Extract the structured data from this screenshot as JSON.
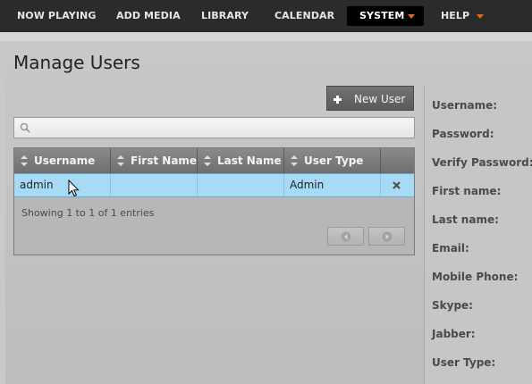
{
  "nav": {
    "items": [
      {
        "label": "NOW PLAYING"
      },
      {
        "label": "ADD MEDIA"
      },
      {
        "label": "LIBRARY"
      },
      {
        "label": "CALENDAR"
      },
      {
        "label": "SYSTEM"
      },
      {
        "label": "HELP"
      }
    ],
    "active": "SYSTEM",
    "caret_color": "#e8661a"
  },
  "page": {
    "title": "Manage Users",
    "new_user_label": "New User",
    "search_placeholder": "",
    "search_value": ""
  },
  "table": {
    "columns": [
      "Username",
      "First Name",
      "Last Name",
      "User Type"
    ],
    "rows": [
      {
        "username": "admin",
        "first_name": "",
        "last_name": "",
        "user_type": "Admin"
      }
    ],
    "info": "Showing 1 to 1 of 1 entries",
    "selected_row_color": "#a6daf5"
  },
  "form": {
    "labels": [
      "Username:",
      "Password:",
      "Verify Password:",
      "First name:",
      "Last name:",
      "Email:",
      "Mobile Phone:",
      "Skype:",
      "Jabber:",
      "User Type:"
    ]
  },
  "icons": [
    "plus-icon",
    "search-icon",
    "sort-icon",
    "delete-icon",
    "arrow-left-icon",
    "arrow-right-icon",
    "mouse-cursor-icon",
    "chevron-down-icon"
  ]
}
